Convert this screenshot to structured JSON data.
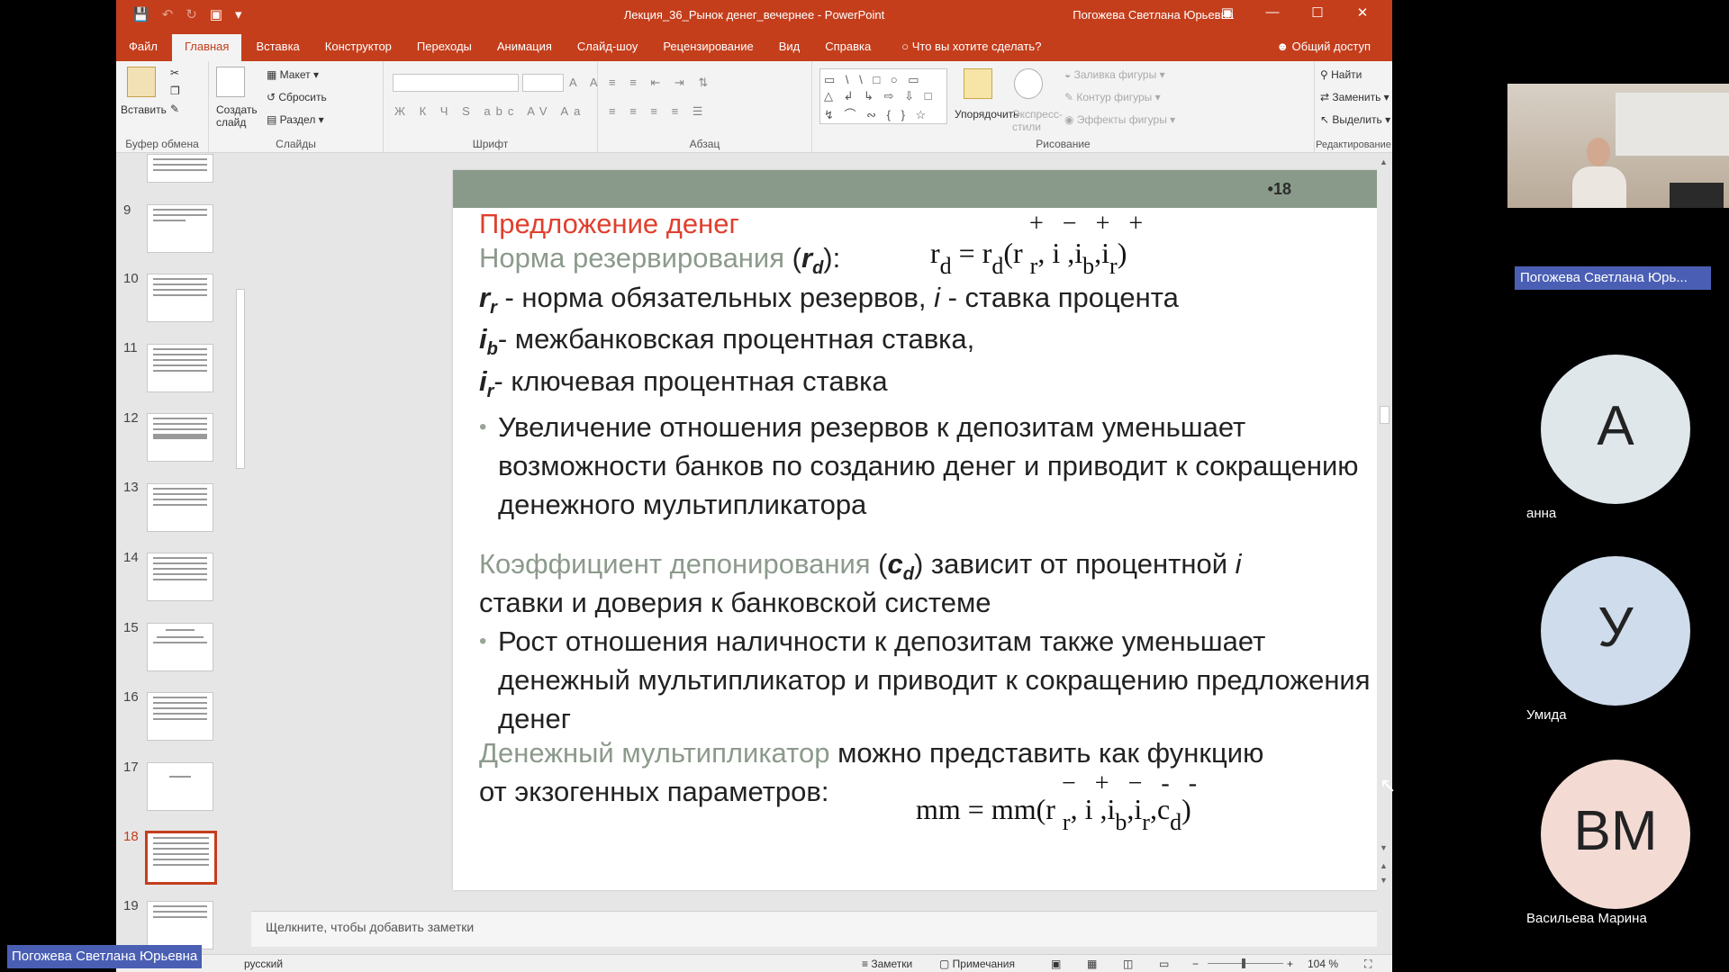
{
  "titlebar": {
    "doc_title": "Лекция_36_Рынок денег_вечернее  -  PowerPoint",
    "user": "Погожева Светлана Юрьевна",
    "qat_icons": [
      "save-icon",
      "undo-icon",
      "redo-icon",
      "start-slideshow-icon",
      "customize-qat-icon"
    ]
  },
  "tabs": {
    "file": "Файл",
    "home": "Главная",
    "insert": "Вставка",
    "design": "Конструктор",
    "transitions": "Переходы",
    "animations": "Анимация",
    "slideshow": "Слайд-шоу",
    "review": "Рецензирование",
    "view": "Вид",
    "help": "Справка",
    "tellme": "Что вы хотите сделать?",
    "share": "Общий доступ"
  },
  "ribbon": {
    "clipboard": {
      "paste": "Вставить",
      "label": "Буфер обмена"
    },
    "slides": {
      "new_slide": "Создать слайд",
      "layout": "Макет",
      "reset": "Сбросить",
      "section": "Раздел",
      "label": "Слайды"
    },
    "font": {
      "label": "Шрифт"
    },
    "paragraph": {
      "label": "Абзац"
    },
    "drawing": {
      "arrange": "Упорядочить",
      "quick_styles": "Экспресс-стили",
      "shape_fill": "Заливка фигуры",
      "shape_outline": "Контур фигуры",
      "shape_effects": "Эффекты фигуры",
      "label": "Рисование"
    },
    "editing": {
      "find": "Найти",
      "replace": "Заменить",
      "select": "Выделить",
      "label": "Редактирование"
    }
  },
  "thumbnails": {
    "numbers": [
      "9",
      "10",
      "11",
      "12",
      "13",
      "14",
      "15",
      "16",
      "17",
      "18",
      "19"
    ],
    "active": "18"
  },
  "slide": {
    "number": "•18",
    "title": "Предложение денег",
    "reserve_ratio_label": "Норма резервирования",
    "reserve_ratio_symbol_open": "(",
    "reserve_ratio_symbol": "r",
    "reserve_ratio_symbol_sub": "d",
    "reserve_ratio_symbol_close": "):",
    "formula1_signs": "+   −  +   +",
    "formula1": "r_d = r_d(r_r, i, i_b, i_r)",
    "rr_symbol": "r",
    "rr_sub": "r",
    "rr_text": " - норма обязательных резервов, ",
    "i_symbol": "i",
    "i_text": " - ставка процента",
    "ib_symbol": "i",
    "ib_sub": "b",
    "ib_text": "- межбанковская процентная ставка,",
    "ir_symbol": "i",
    "ir_sub": "r",
    "ir_text": "- ключевая процентная ставка",
    "bullet1": "Увеличение отношения резервов к депозитам уменьшает возможности банков по созданию денег и приводит к сокращению денежного мультипликатора",
    "deposit_coef_label": "Коэффициент депонирования",
    "deposit_coef_symbol": "c",
    "deposit_coef_sub": "d",
    "deposit_coef_text": " зависит от процентной ",
    "deposit_coef_i": "i",
    "deposit_coef_text2": "ставки и доверия к банковской системе",
    "bullet2": "Рост отношения наличности к депозитам также уменьшает денежный мультипликатор и приводит к сокращению предложения денег",
    "multiplier_label": "Денежный мультипликатор",
    "multiplier_text": " можно представить как функцию",
    "multiplier_text2": "от экзогенных параметров:",
    "formula2_signs": "−   +  −   -   -",
    "formula2": "mm = mm(r_r, i, i_b, i_r, c_d)"
  },
  "notes": {
    "placeholder": "Щелкните, чтобы добавить заметки"
  },
  "statusbar": {
    "language": "русский",
    "notes": "Заметки",
    "comments": "Примечания",
    "zoom": "104 %"
  },
  "call": {
    "presenter": "Погожева Светлана Юрь...",
    "presenter_full": "Погожева Светлана Юрьевна",
    "participants": [
      {
        "initials": "А",
        "name": "анна",
        "color": "#dfe7ea"
      },
      {
        "initials": "У",
        "name": "Умида",
        "color": "#cfdceb"
      },
      {
        "initials": "ВМ",
        "name": "Васильева Марина",
        "color": "#f3dbd4"
      }
    ]
  },
  "colors": {
    "accent": "#c43e1c",
    "slide_header": "#8a9a8a",
    "title_red": "#e0402e",
    "badge": "#4a5fb4"
  }
}
